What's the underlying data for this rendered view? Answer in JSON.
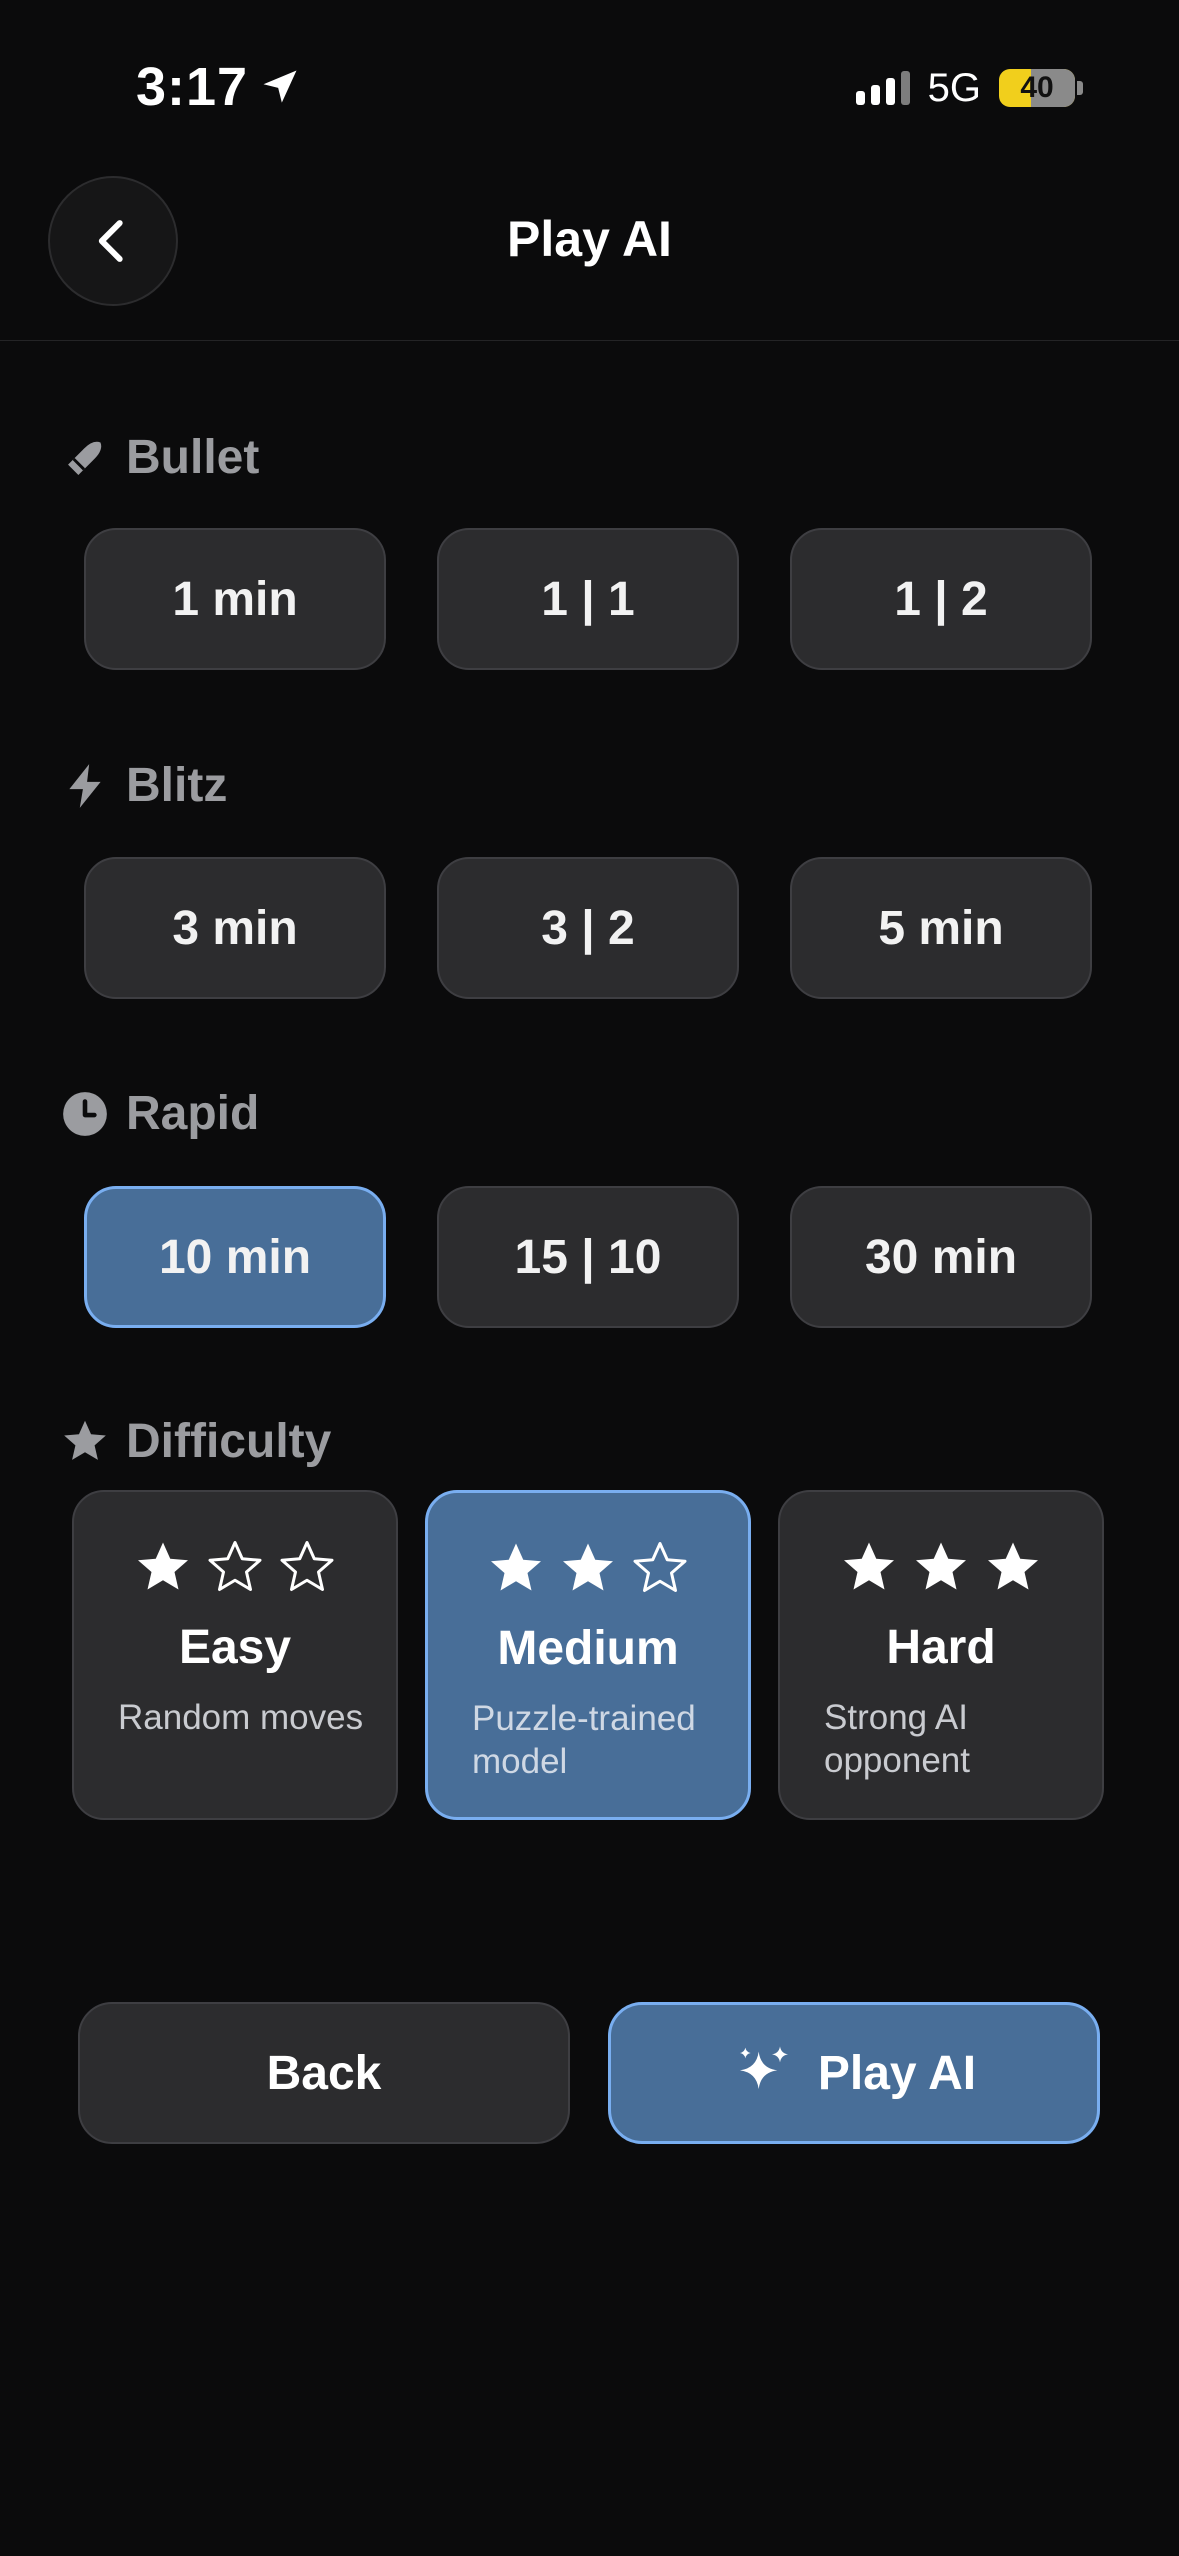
{
  "status": {
    "time": "3:17",
    "network": "5G",
    "battery": "40"
  },
  "header": {
    "title": "Play AI"
  },
  "sections": {
    "bullet": {
      "title": "Bullet",
      "options": [
        "1 min",
        "1 | 1",
        "1 | 2"
      ]
    },
    "blitz": {
      "title": "Blitz",
      "options": [
        "3 min",
        "3 | 2",
        "5 min"
      ]
    },
    "rapid": {
      "title": "Rapid",
      "options": [
        "10 min",
        "15 | 10",
        "30 min"
      ],
      "selected": "10 min"
    },
    "difficulty": {
      "title": "Difficulty",
      "levels": [
        {
          "name": "Easy",
          "desc": "Random moves",
          "stars": 1
        },
        {
          "name": "Medium",
          "desc": "Puzzle-trained model",
          "stars": 2
        },
        {
          "name": "Hard",
          "desc": "Strong AI opponent",
          "stars": 3
        }
      ],
      "selected": "Medium"
    }
  },
  "actions": {
    "back_label": "Back",
    "play_label": "Play AI"
  },
  "colors": {
    "background": "#0b0b0c",
    "accent": "#486e98",
    "accent_border": "#79aef0",
    "card": "#2c2c2e",
    "battery": "#f1cf1c"
  }
}
